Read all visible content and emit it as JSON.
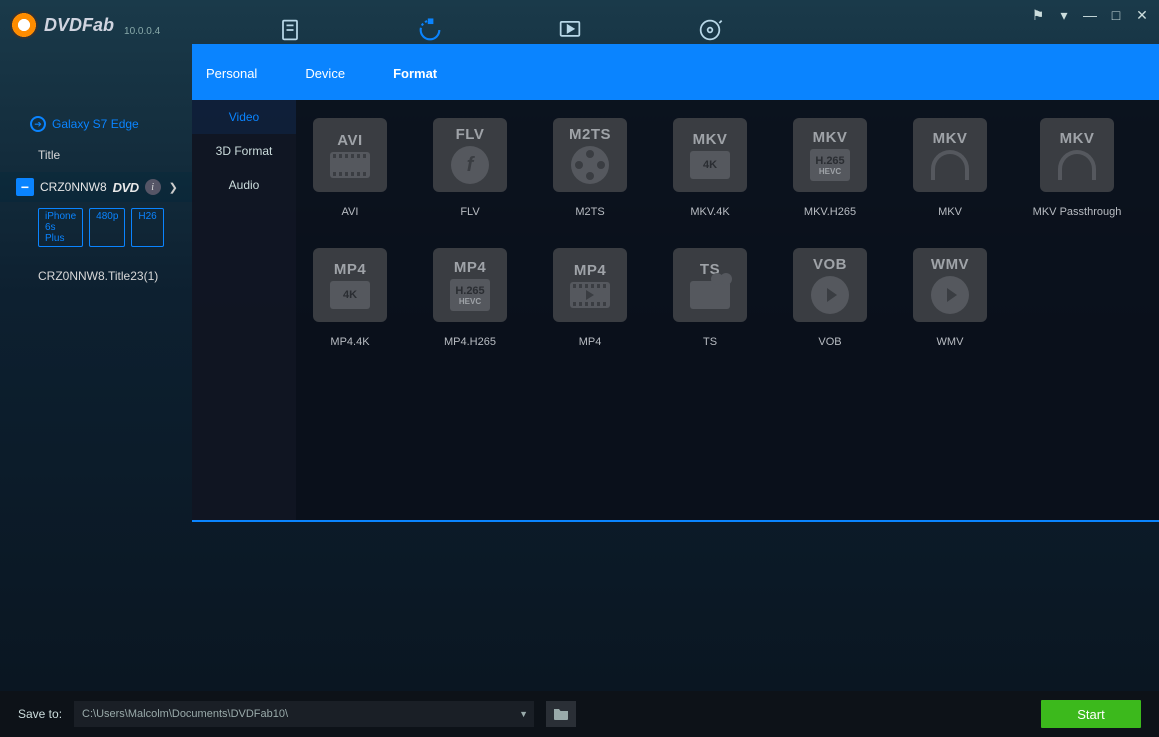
{
  "app": {
    "name": "DVDFab",
    "version": "10.0.0.4"
  },
  "window_controls": {
    "pin": "⚑",
    "menu": "▾",
    "min": "—",
    "max": "□",
    "close": "✕"
  },
  "profile_target": "Galaxy S7 Edge",
  "source": {
    "title_header": "Title",
    "item_name": "CRZ0NNW8",
    "disc_badge": "DVD",
    "tags": [
      "iPhone 6s Plus",
      "480p",
      "H26"
    ],
    "subtitle": "CRZ0NNW8.Title23(1)"
  },
  "panel": {
    "tabs": [
      "Personal",
      "Device",
      "Format"
    ],
    "active_tab": 2,
    "categories": [
      "Video",
      "3D Format",
      "Audio"
    ],
    "active_cat": 0,
    "formats": [
      {
        "top": "AVI",
        "label": "AVI",
        "style": "strip"
      },
      {
        "top": "FLV",
        "label": "FLV",
        "style": "flash"
      },
      {
        "top": "M2TS",
        "label": "M2TS",
        "style": "reel"
      },
      {
        "top": "MKV",
        "label": "MKV.4K",
        "mid": "4K",
        "style": "mid"
      },
      {
        "top": "MKV",
        "label": "MKV.H265",
        "mid": "H.265",
        "sub": "HEVC",
        "style": "mid2"
      },
      {
        "top": "MKV",
        "label": "MKV",
        "style": "arc"
      },
      {
        "top": "MKV",
        "label": "MKV Passthrough",
        "style": "arc"
      },
      {
        "top": "MP4",
        "label": "MP4.4K",
        "mid": "4K",
        "style": "mid"
      },
      {
        "top": "MP4",
        "label": "MP4.H265",
        "mid": "H.265",
        "sub": "HEVC",
        "style": "mid2"
      },
      {
        "top": "MP4",
        "label": "MP4",
        "style": "strip_play"
      },
      {
        "top": "TS",
        "label": "TS",
        "style": "cam"
      },
      {
        "top": "VOB",
        "label": "VOB",
        "style": "circ"
      },
      {
        "top": "WMV",
        "label": "WMV",
        "style": "circ"
      }
    ]
  },
  "footer": {
    "save_label": "Save to:",
    "path": "C:\\Users\\Malcolm\\Documents\\DVDFab10\\",
    "start": "Start"
  }
}
